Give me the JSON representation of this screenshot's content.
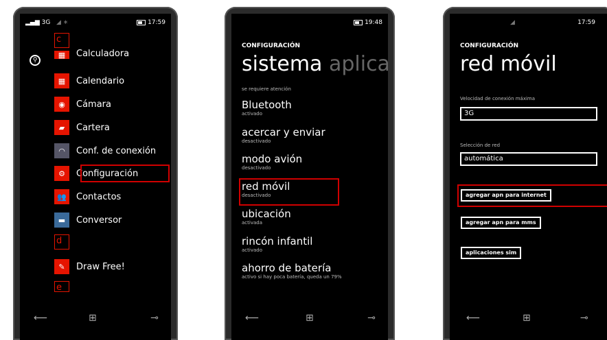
{
  "phone1": {
    "status": {
      "signal": "3G",
      "time": "17:59"
    },
    "letters": [
      "c",
      "d",
      "e"
    ],
    "apps": [
      {
        "label": "Calculadora",
        "icon": "calculator-icon"
      },
      {
        "label": "Calendario",
        "icon": "calendar-icon"
      },
      {
        "label": "Cámara",
        "icon": "camera-icon"
      },
      {
        "label": "Cartera",
        "icon": "wallet-icon"
      },
      {
        "label": "Conf. de conexión",
        "icon": "connection-settings-icon"
      },
      {
        "label": "Configuración",
        "icon": "gear-icon"
      },
      {
        "label": "Contactos",
        "icon": "contacts-icon"
      },
      {
        "label": "Conversor",
        "icon": "converter-icon"
      },
      {
        "label": "Draw Free!",
        "icon": "draw-free-icon"
      }
    ]
  },
  "phone2": {
    "status": {
      "time": "19:48"
    },
    "header": "CONFIGURACIÓN",
    "pivot_active": "sistema",
    "pivot_next": "aplicac",
    "attention": "se requiere atención",
    "items": [
      {
        "title": "Bluetooth",
        "sub": "activado"
      },
      {
        "title": "acercar y enviar",
        "sub": "desactivado"
      },
      {
        "title": "modo avión",
        "sub": "desactivado"
      },
      {
        "title": "red móvil",
        "sub": "desactivado"
      },
      {
        "title": "ubicación",
        "sub": "activada"
      },
      {
        "title": "rincón infantil",
        "sub": "activado"
      },
      {
        "title": "ahorro de batería",
        "sub": "activo si hay poca batería, queda un 79%"
      }
    ]
  },
  "phone3": {
    "status": {
      "time": "17:59"
    },
    "header": "CONFIGURACIÓN",
    "title": "red móvil",
    "speed_label": "Velocidad de conexión máxima",
    "speed_value": "3G",
    "network_label": "Selección de red",
    "network_value": "automática",
    "btn_internet": "agregar apn para internet",
    "btn_mms": "agregar apn para mms",
    "btn_sim": "aplicaciones sim"
  },
  "colors": {
    "accent": "#e51400",
    "highlight": "#d10000"
  }
}
